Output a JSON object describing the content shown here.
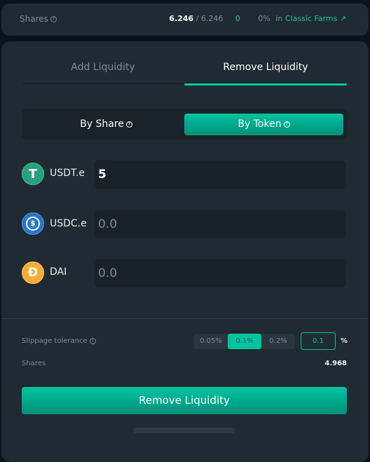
{
  "summary": {
    "label": "Shares",
    "owned": "6.246",
    "total": "/ 6.246",
    "staked": "0",
    "percent": "0%",
    "in": "in",
    "farm_link": "Classic Farms"
  },
  "tabs": [
    {
      "label": "Add Liquidity",
      "active": false
    },
    {
      "label": "Remove Liquidity",
      "active": true
    }
  ],
  "mode": {
    "by_share": "By Share",
    "by_token": "By Token",
    "selected": "By Token"
  },
  "tokens": [
    {
      "symbol": "USDT.e",
      "value": "5",
      "icon": "tether-icon",
      "color": "#26a17b"
    },
    {
      "symbol": "USDC.e",
      "value": "",
      "placeholder": "0.0",
      "icon": "usdc-icon",
      "color": "#2775ca"
    },
    {
      "symbol": "DAI",
      "value": "",
      "placeholder": "0.0",
      "icon": "dai-icon",
      "color": "#f5ac37"
    }
  ],
  "slippage": {
    "label": "Slippage tolerance",
    "options": [
      "0.05%",
      "0.1%",
      "0.2%"
    ],
    "selected": "0.1%",
    "custom": "0.1",
    "unit": "%"
  },
  "shares": {
    "label": "Shares",
    "value": "4.968"
  },
  "submit": "Remove Liquidity",
  "colors": {
    "accent": "#00c4a0",
    "background": "#07131d",
    "card": "#1f2a32"
  }
}
